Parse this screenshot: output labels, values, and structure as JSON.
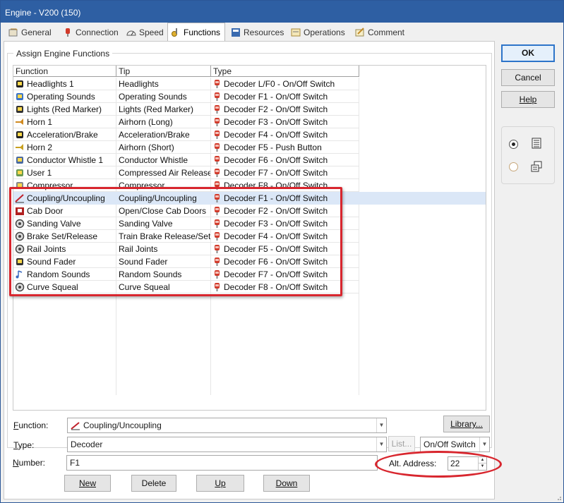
{
  "window": {
    "title": "Engine - V200 (150)"
  },
  "tabs": [
    {
      "label": "General",
      "icon": "general-icon",
      "active": false
    },
    {
      "label": "Connection",
      "icon": "connection-plug-icon",
      "active": false
    },
    {
      "label": "Speed",
      "icon": "speedometer-icon",
      "active": false
    },
    {
      "label": "Functions",
      "icon": "functions-icon",
      "active": true
    },
    {
      "label": "Resources",
      "icon": "resources-icon",
      "active": false
    },
    {
      "label": "Operations",
      "icon": "operations-icon",
      "active": false
    },
    {
      "label": "Comment",
      "icon": "comment-icon",
      "active": false
    }
  ],
  "group": {
    "label": "Assign Engine Functions"
  },
  "grid": {
    "headers": {
      "function": "Function",
      "tip": "Tip",
      "type": "Type"
    },
    "rows": [
      {
        "function": "Headlights 1",
        "tip": "Headlights",
        "type": "Decoder L/F0 - On/Off Switch",
        "icon": "headlight-icon"
      },
      {
        "function": "Operating Sounds",
        "tip": "Operating Sounds",
        "type": "Decoder F1 - On/Off Switch",
        "icon": "sound-gear-icon"
      },
      {
        "function": "Lights (Red Marker)",
        "tip": "Lights (Red Marker)",
        "type": "Decoder F2 - On/Off Switch",
        "icon": "marker-light-icon"
      },
      {
        "function": "Horn 1",
        "tip": "Airhorn (Long)",
        "type": "Decoder F3 - On/Off Switch",
        "icon": "horn-icon"
      },
      {
        "function": "Acceleration/Brake",
        "tip": "Acceleration/Brake",
        "type": "Decoder F4 - On/Off Switch",
        "icon": "abv-icon"
      },
      {
        "function": "Horn 2",
        "tip": "Airhorn (Short)",
        "type": "Decoder F5 - Push Button",
        "icon": "horn2-icon"
      },
      {
        "function": "Conductor Whistle 1",
        "tip": "Conductor Whistle",
        "type": "Decoder F6 - On/Off Switch",
        "icon": "conductor-icon"
      },
      {
        "function": "User 1",
        "tip": "Compressed Air Release",
        "type": "Decoder F7 - On/Off Switch",
        "icon": "user-icon"
      },
      {
        "function": "Compressor",
        "tip": "Compressor",
        "type": "Decoder F8 - On/Off Switch",
        "icon": "compressor-icon"
      },
      {
        "function": "Coupling/Uncoupling",
        "tip": "Coupling/Uncoupling",
        "type": "Decoder F1 - On/Off Switch",
        "icon": "coupling-icon",
        "selected": true
      },
      {
        "function": "Cab Door",
        "tip": "Open/Close Cab Doors",
        "type": "Decoder F2 - On/Off Switch",
        "icon": "cab-door-icon"
      },
      {
        "function": "Sanding Valve",
        "tip": "Sanding Valve",
        "type": "Decoder F3 - On/Off Switch",
        "icon": "speaker-icon"
      },
      {
        "function": "Brake Set/Release",
        "tip": "Train Brake Release/Set",
        "type": "Decoder F4 - On/Off Switch",
        "icon": "speaker-icon"
      },
      {
        "function": "Rail Joints",
        "tip": "Rail Joints",
        "type": "Decoder F5 - On/Off Switch",
        "icon": "speaker-icon"
      },
      {
        "function": "Sound Fader",
        "tip": "Sound Fader",
        "type": "Decoder F6 - On/Off Switch",
        "icon": "fader-icon"
      },
      {
        "function": "Random Sounds",
        "tip": "Random Sounds",
        "type": "Decoder F7 - On/Off Switch",
        "icon": "music-note-icon"
      },
      {
        "function": "Curve Squeal",
        "tip": "Curve Squeal",
        "type": "Decoder F8 - On/Off Switch",
        "icon": "speaker-icon"
      }
    ]
  },
  "form": {
    "function_label": "Function:",
    "function_value": "Coupling/Uncoupling",
    "library_button": "Library...",
    "type_label": "Type:",
    "type_value": "Decoder",
    "list_button": "List...",
    "switch_value": "On/Off Switch",
    "number_label": "Number:",
    "number_value": "F1",
    "alt_address_label": "Alt. Address:",
    "alt_address_value": "22",
    "new_button": "New",
    "delete_button": "Delete",
    "up_button": "Up",
    "down_button": "Down"
  },
  "side": {
    "ok": "OK",
    "cancel": "Cancel",
    "help": "Help"
  },
  "colors": {
    "titlebar": "#2e5fa3",
    "selection": "#dbe7f7",
    "annotation_red": "#d8262e",
    "plug_red": "#d23a2a"
  }
}
